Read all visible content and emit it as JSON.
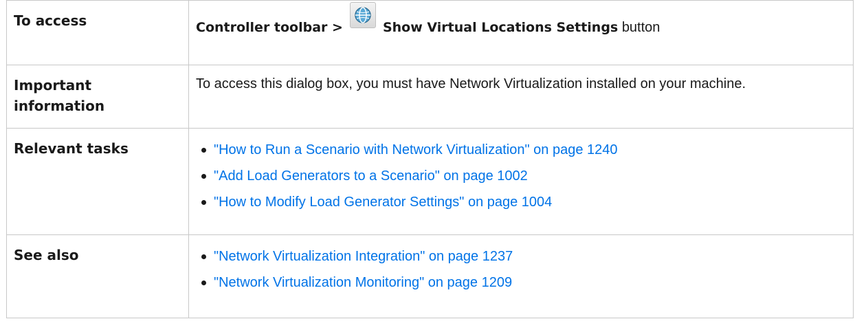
{
  "rows": {
    "access": {
      "label": "To access",
      "path_prefix": "Controller toolbar >",
      "button_name": "Show Virtual Locations Settings",
      "suffix": "button",
      "icon": "virtual-locations-globe-icon"
    },
    "important": {
      "label_line1": "Important",
      "label_line2": "information",
      "text": "To access this dialog box, you must have Network Virtualization installed on your machine."
    },
    "tasks": {
      "label": "Relevant tasks",
      "links": [
        "\"How to Run a Scenario with Network Virtualization\" on page 1240",
        "\"Add Load Generators to a Scenario\" on page 1002",
        "\"How to Modify Load Generator Settings\" on page 1004"
      ]
    },
    "see_also": {
      "label": "See also",
      "links": [
        "\"Network Virtualization Integration\" on page 1237",
        "\"Network Virtualization Monitoring\" on page 1209"
      ]
    }
  },
  "colors": {
    "link": "#0073e7",
    "border": "#c8c8c8",
    "text": "#1a1a1a"
  }
}
